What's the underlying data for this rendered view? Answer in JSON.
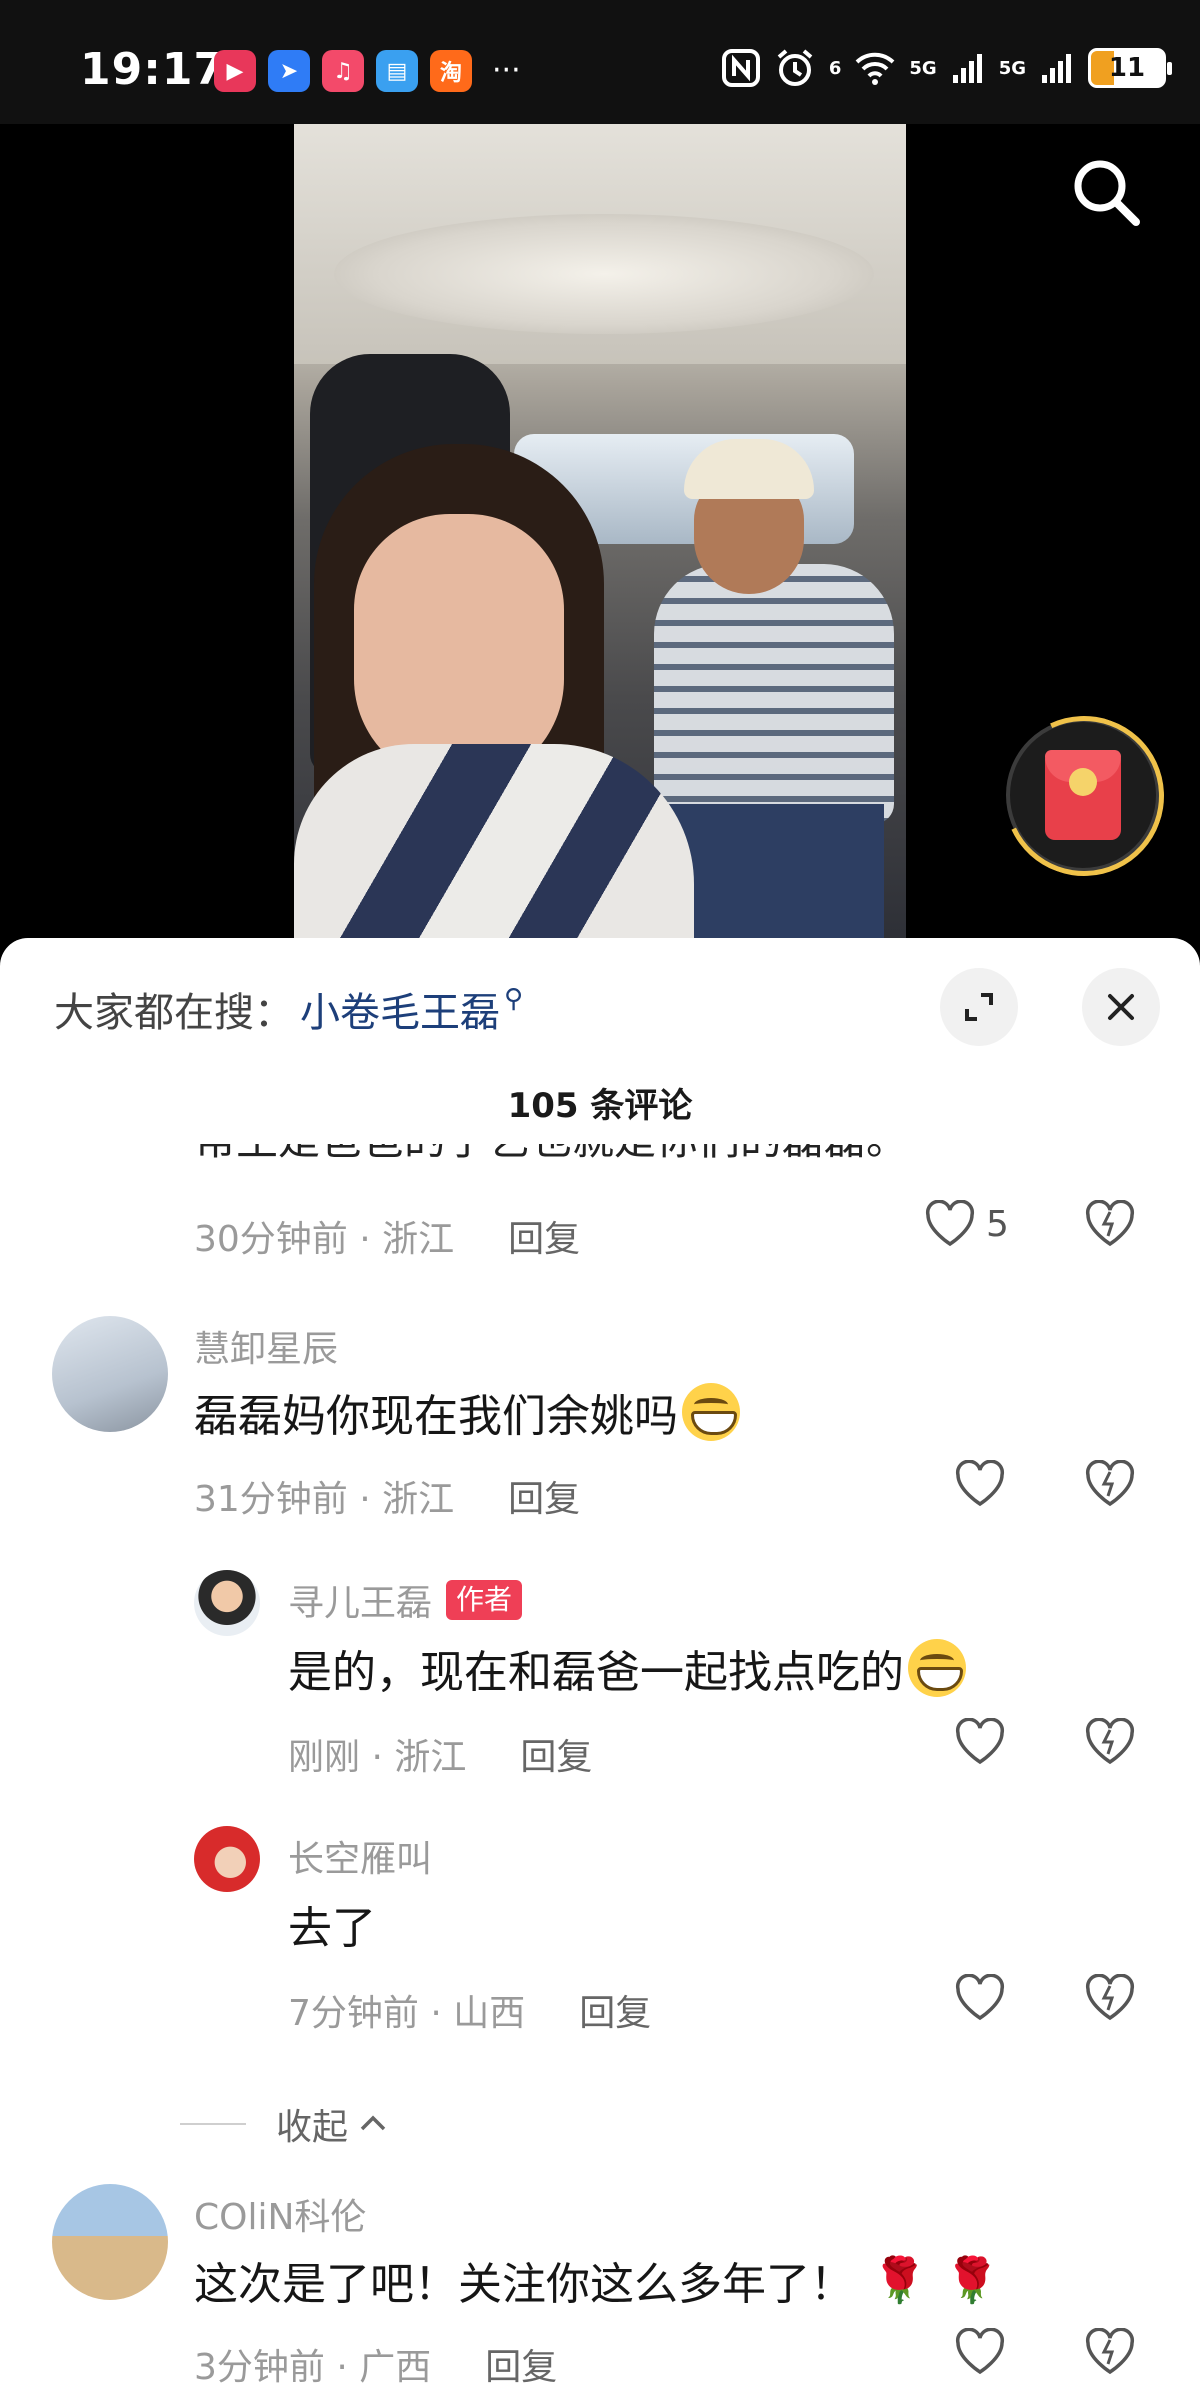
{
  "status_bar": {
    "time": "19:17",
    "apps": [
      {
        "icon": "video-app-icon",
        "color": "#e8375a",
        "glyph": "▶"
      },
      {
        "icon": "feishu-app-icon",
        "color": "#2f7cf6",
        "glyph": "➤"
      },
      {
        "icon": "music-app-icon",
        "color": "#f34a6a",
        "glyph": "♫"
      },
      {
        "icon": "reader-app-icon",
        "color": "#3aa0f0",
        "glyph": "▤"
      },
      {
        "icon": "taobao-app-icon",
        "color": "#ff6a1a",
        "glyph": "淘"
      }
    ],
    "more": "···",
    "network_a": "6",
    "network_b": "5G",
    "network_c": "5G",
    "battery": "11"
  },
  "sheet": {
    "hot_search_label": "大家都在搜：",
    "hot_search_term": "小卷毛王磊",
    "title": "105 条评论",
    "cut_text": "常生是爸爸的手艺也就是你们的磊磊。"
  },
  "comments": [
    {
      "meta": "30分钟前 · 浙江",
      "reply": "回复",
      "likes": "5"
    },
    {
      "name": "慧卸星辰",
      "text": "磊磊妈你现在我们余姚吗",
      "meta": "31分钟前 · 浙江",
      "reply": "回复",
      "likes": ""
    },
    {
      "name": "寻儿王磊",
      "tag": "作者",
      "text": "是的，现在和磊爸一起找点吃的",
      "meta": "刚刚 · 浙江",
      "reply": "回复",
      "likes": ""
    },
    {
      "name": "长空雁叫",
      "text": "去了",
      "meta": "7分钟前 · 山西",
      "reply": "回复",
      "likes": ""
    },
    {
      "name": "COliN科伦",
      "text": "这次是了吧！关注你这么多年了！",
      "meta": "3分钟前 · 广西",
      "reply": "回复",
      "likes": ""
    }
  ],
  "collapse_label": "收起"
}
